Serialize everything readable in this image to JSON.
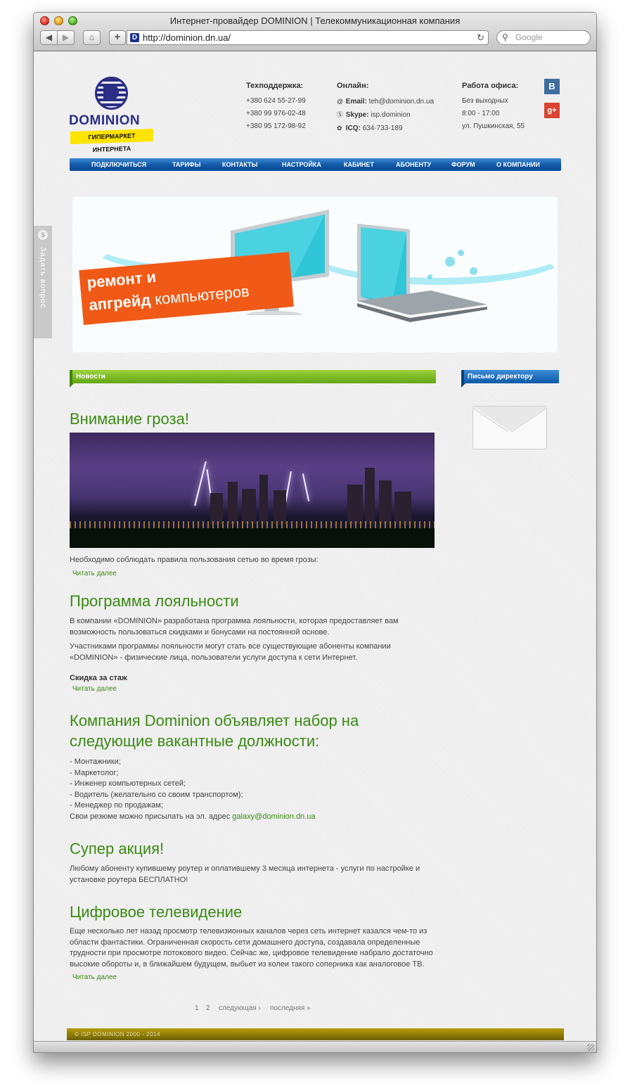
{
  "window": {
    "title": "Интернет-провайдер DOMINION | Телекоммуникационная компания"
  },
  "toolbar": {
    "back_icon": "◀",
    "forward_icon": "▶",
    "home_icon": "⌂",
    "add_icon": "+",
    "url": "http://dominion.dn.ua/",
    "reload_icon": "↻",
    "search_placeholder": "Google",
    "search_icon": "🔍"
  },
  "header": {
    "logo_text": "DOMINION",
    "logo_tagline": "ГИПЕРМАРКЕТ ИНТЕРНЕТА",
    "support": {
      "heading": "Техподдержка:",
      "phones": [
        "+380 624 55-27-99",
        "+380 99 976-02-48",
        "+380 95 172-98-92"
      ]
    },
    "online": {
      "heading": "Онлайн:",
      "email_label": "Email:",
      "email": "teh@dominion.dn.ua",
      "skype_label": "Skype:",
      "skype": "isp.dominion",
      "icq_label": "ICQ:",
      "icq": "634-733-189"
    },
    "office": {
      "heading": "Работа офиса:",
      "lines": [
        "Без выходных",
        "8:00 - 17:00",
        "ул. Пушкинская, 55"
      ]
    },
    "social": {
      "vk": "В",
      "gplus": "g+"
    }
  },
  "menu": [
    "ПОДКЛЮЧИТЬСЯ",
    "ТАРИФЫ",
    "КОНТАКТЫ",
    "НАСТРОЙКА",
    "КАБИНЕТ",
    "АБОНЕНТУ",
    "ФОРУМ",
    "О КОМПАНИИ"
  ],
  "banner": {
    "line1": "ремонт и",
    "line2_bold": "апгрейд",
    "line2_rest": "компьютеров"
  },
  "ask_tab": {
    "label": "Задать вопрос",
    "icon": "$"
  },
  "news_label": "Новости",
  "director_label": "Письмо директору",
  "articles": {
    "storm": {
      "title": "Внимание гроза!",
      "text": "Необходимо соблюдать правила пользования сетью во время грозы:",
      "read_more": "Читать далее"
    },
    "loyalty": {
      "title": "Программа лояльности",
      "p1": "В компании «DOMINION» разработана программа лояльности, которая предоставляет вам возможность пользоваться скидками и бонусами на постоянной основе.",
      "p2": "Участниками программы лояльности могут стать все существующие абоненты компании «DOMINION» - физические лица, пользователи услуги доступа к сети Интернет.",
      "bold": "Скидка за стаж",
      "read_more": "Читать далее"
    },
    "vacancy": {
      "title": "Компания Dominion объявляет набор на следующие вакантные должности:",
      "items": [
        "- Монтажники;",
        "- Маркетолог;",
        "- Инженер компьютерных сетей;",
        "- Водитель (желательно со своим транспортом);",
        "- Менеджер по продажам;"
      ],
      "resume_text": "Свои резюме можно присылать на эл. адрес ",
      "resume_email": "galaxy@dominion.dn.ua"
    },
    "promo": {
      "title": "Супер акция!",
      "text": "Любому абоненту купившему роутер и оплатившему 3 месяца интернета - услуги по настройке и установке роутера БЕСПЛАТНО!"
    },
    "tv": {
      "title": "Цифровое телевидение",
      "text": "Еще несколько лет назад просмотр телевизионных каналов через сеть интернет казался чем-то из области фантастики. Ограниченная скорость сети домашнего доступа, создавала определенные трудности при просмотре потокового видео. Сейчас же, цифровое телевидение набрало достаточно высокие обороты и, в ближайшем будущем, выбьет из колеи такого соперника как аналоговое ТВ.",
      "read_more": "Читать далее"
    }
  },
  "pager": {
    "current": "1",
    "page2": "2",
    "next": "следующая ›",
    "last": "последняя »"
  },
  "footer": {
    "text": "© ISP DOMINION 2000 - 2014"
  }
}
